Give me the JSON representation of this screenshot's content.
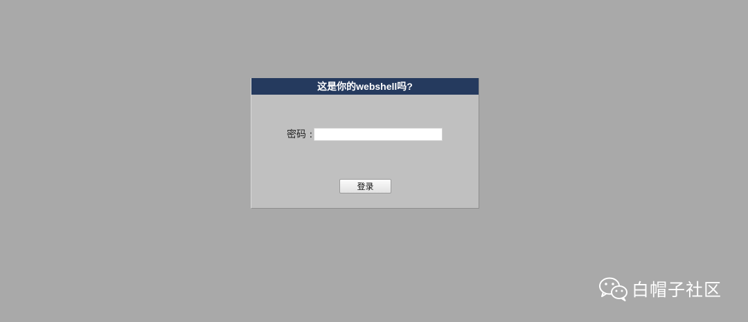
{
  "login_panel": {
    "title": "这是你的webshell吗?",
    "password_label": "密码 :",
    "password_value": "",
    "login_button_label": "登录"
  },
  "watermark": {
    "icon": "wechat-icon",
    "text": "白帽子社区"
  },
  "colors": {
    "page_background": "#a9a9a9",
    "panel_background": "#c0c0c0",
    "header_background": "#253a5e",
    "header_text": "#ffffff"
  }
}
